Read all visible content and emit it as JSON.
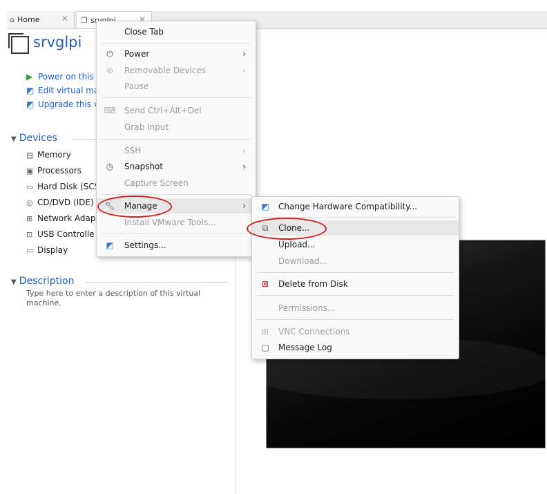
{
  "tabs": [
    {
      "label": "Home",
      "icon": "home-icon"
    },
    {
      "label": "srvglpi",
      "icon": "vm-icon"
    }
  ],
  "vm": {
    "title": "srvglpi",
    "actions": [
      {
        "label": "Power on this",
        "icon": "play-icon"
      },
      {
        "label": "Edit virtual ma",
        "icon": "edit-vm-icon"
      },
      {
        "label": "Upgrade this v",
        "icon": "upgrade-vm-icon"
      }
    ]
  },
  "devices": {
    "heading": "Devices",
    "items": [
      {
        "label": "Memory",
        "icon": "memory-icon"
      },
      {
        "label": "Processors",
        "icon": "processor-icon"
      },
      {
        "label": "Hard Disk (SCS",
        "icon": "harddisk-icon"
      },
      {
        "label": "CD/DVD (IDE)",
        "icon": "cd-icon"
      },
      {
        "label": "Network Adap",
        "icon": "network-icon"
      },
      {
        "label": "USB Controlle",
        "icon": "usb-icon"
      },
      {
        "label": "Display",
        "icon": "display-icon"
      }
    ]
  },
  "description": {
    "heading": "Description",
    "placeholder": "Type here to enter a description of this virtual machine."
  },
  "context_menu": {
    "items": [
      {
        "label": "Close Tab"
      },
      {
        "label": "Power",
        "icon": "power-icon"
      },
      {
        "label": "Removable Devices",
        "icon": "removable-icon"
      },
      {
        "label": "Pause"
      },
      {
        "label": "Send Ctrl+Alt+Del",
        "icon": "keyboard-icon"
      },
      {
        "label": "Grab Input"
      },
      {
        "label": "SSH"
      },
      {
        "label": "Snapshot",
        "icon": "snapshot-icon"
      },
      {
        "label": "Capture Screen"
      },
      {
        "label": "Manage",
        "icon": "wrench-icon"
      },
      {
        "label": "Install VMware Tools..."
      },
      {
        "label": "Settings...",
        "icon": "settings-icon"
      }
    ]
  },
  "manage_menu": {
    "items": [
      {
        "label": "Change Hardware Compatibility...",
        "icon": "hw-compat-icon"
      },
      {
        "label": "Clone...",
        "icon": "clone-icon"
      },
      {
        "label": "Upload..."
      },
      {
        "label": "Download..."
      },
      {
        "label": "Delete from Disk",
        "icon": "delete-disk-icon"
      },
      {
        "label": "Permissions..."
      },
      {
        "label": "VNC Connections",
        "icon": "vnc-icon"
      },
      {
        "label": "Message Log",
        "icon": "message-log-icon"
      }
    ]
  },
  "colors": {
    "accent": "#1f5fbf",
    "annotation": "#d61f1f"
  }
}
